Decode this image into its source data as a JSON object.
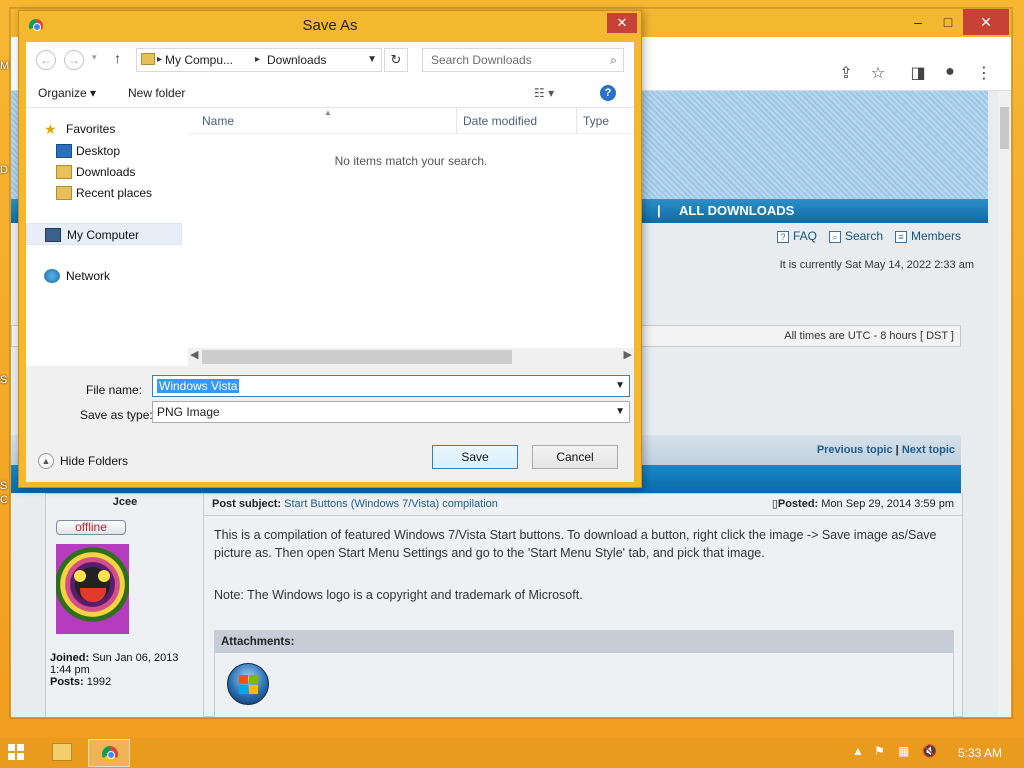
{
  "desktop": {
    "edge_letters": [
      "M",
      "D",
      "S",
      "S",
      "C"
    ]
  },
  "browser": {
    "window_buttons": [
      "–",
      "□",
      "✕"
    ],
    "toolbar_icons": [
      "share-icon",
      "star-icon",
      "sidebar-icon",
      "profile-icon",
      "menu-icon"
    ],
    "page": {
      "nav_separator": "|",
      "nav_all_downloads": "ALL DOWNLOADS",
      "links": {
        "faq": "FAQ",
        "search": "Search",
        "members": "Members"
      },
      "current_time": "It is currently Sat May 14, 2022 2:33 am",
      "timezone_text": "All times are UTC - 8 hours [ DST ]",
      "previous_topic": "Previous topic",
      "topic_sep": "|",
      "next_topic": "Next topic",
      "post": {
        "author": "Jcee",
        "status": "offline",
        "joined_label": "Joined:",
        "joined_value": "Sun Jan 06, 2013 1:44 pm",
        "posts_label": "Posts:",
        "posts_value": "1992",
        "subject_label": "Post subject:",
        "subject_value": "Start Buttons (Windows 7/Vista) compilation",
        "posted_label": "Posted:",
        "posted_value": "Mon Sep 29, 2014 3:59 pm",
        "body": "This is a compilation of featured Windows 7/Vista Start buttons. To download a button, right click the image -> Save image as/Save picture as. Then open Start Menu Settings and go to the 'Start Menu Style' tab, and pick that image.",
        "note": "Note: The Windows logo is a copyright and trademark of Microsoft.",
        "attachments_label": "Attachments:"
      }
    }
  },
  "dialog": {
    "title": "Save As",
    "close_glyph": "✕",
    "address": {
      "seg1": "My Compu...",
      "seg2": "Downloads"
    },
    "search_placeholder": "Search Downloads",
    "organize": "Organize ▾",
    "new_folder": "New folder",
    "nav": {
      "favorites": "Favorites",
      "desktop": "Desktop",
      "downloads": "Downloads",
      "recent": "Recent places",
      "my_computer": "My Computer",
      "network": "Network"
    },
    "columns": {
      "name": "Name",
      "date": "Date modified",
      "type": "Type"
    },
    "empty_message": "No items match your search.",
    "file_name_label": "File name:",
    "file_name_value": "Windows Vista",
    "save_type_label": "Save as type:",
    "save_type_value": "PNG Image",
    "hide_folders": "Hide Folders",
    "save_button": "Save",
    "cancel_button": "Cancel"
  },
  "taskbar": {
    "clock": "5:33 AM"
  }
}
